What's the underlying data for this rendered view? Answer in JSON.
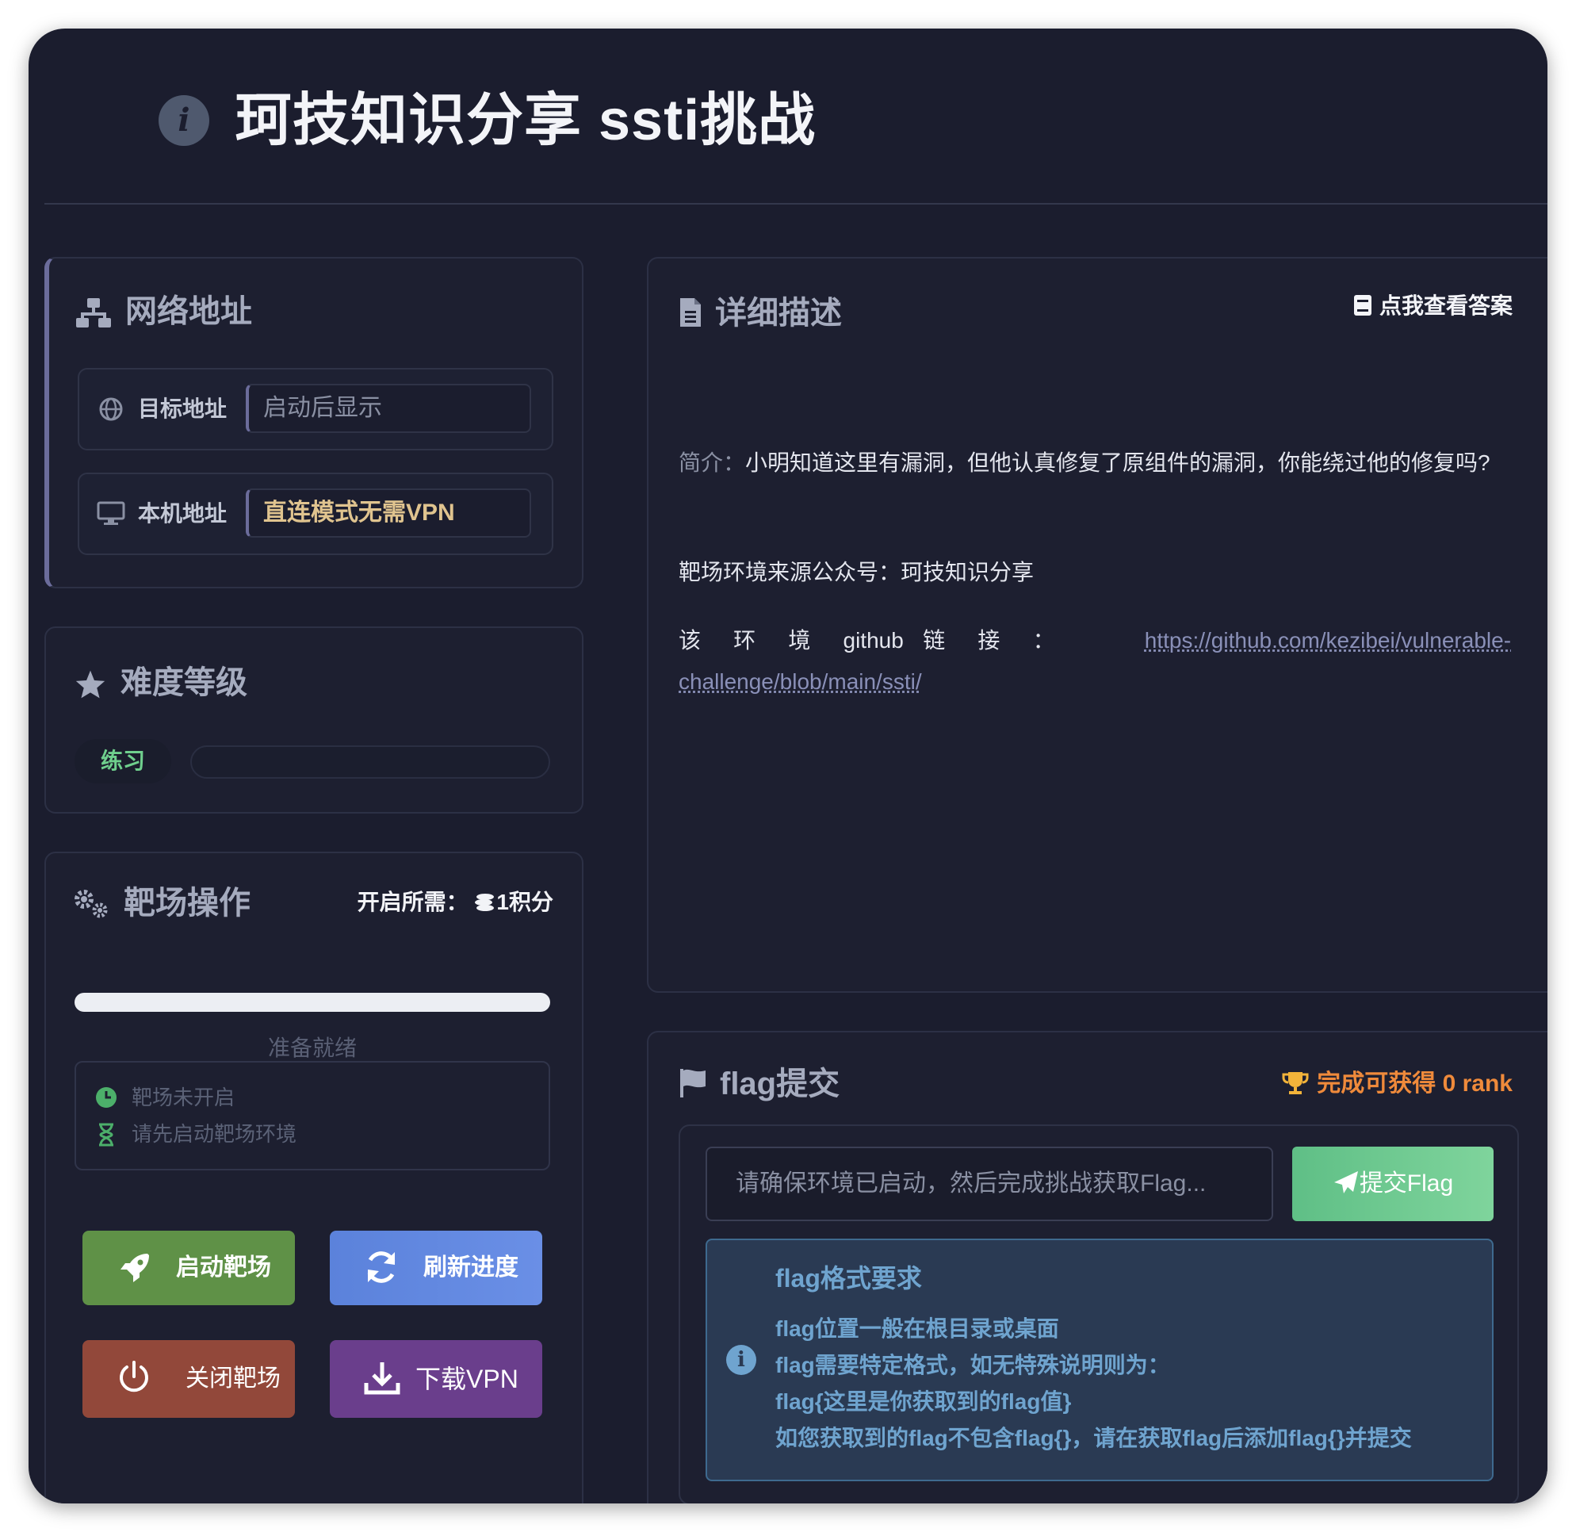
{
  "header": {
    "title": "珂技知识分享 ssti挑战",
    "icon": "info-icon"
  },
  "network": {
    "title": "网络地址",
    "target_label": "目标地址",
    "target_value": "启动后显示",
    "local_label": "本机地址",
    "local_value": "直连模式无需VPN"
  },
  "difficulty": {
    "title": "难度等级",
    "level": "练习",
    "level_color": "#6fcf8d"
  },
  "operations": {
    "title": "靶场操作",
    "cost_label": "开启所需：",
    "cost_value": "1积分",
    "progress_status": "准备就绪",
    "status_line1": "靶场未开启",
    "status_line2": "请先启动靶场环境",
    "start_button": "启动靶场",
    "refresh_button": "刷新进度",
    "stop_button": "关闭靶场",
    "download_button": "下载VPN"
  },
  "detail": {
    "title": "详细描述",
    "answer_link": "点我查看答案",
    "intro_label": "简介：",
    "intro_text": "小明知道这里有漏洞，但他认真修复了原组件的漏洞，你能绕过他的修复吗?",
    "source_text": "靶场环境来源公众号：珂技知识分享",
    "github_label": "该 环 境 github 链 接 ：",
    "github_url": "https://github.com/kezibei/vulnerable-challenge/blob/main/ssti/"
  },
  "flag": {
    "title": "flag提交",
    "reward": "完成可获得 0 rank",
    "input_placeholder": "请确保环境已启动，然后完成挑战获取Flag...",
    "submit_button": "提交Flag",
    "info_title": "flag格式要求",
    "info_line1": "flag位置一般在根目录或桌面",
    "info_line2": "flag需要特定格式，如无特殊说明则为：",
    "info_line3": "flag{这里是你获取到的flag值}",
    "info_line4": "如您获取到的flag不包含flag{}，请在获取flag后添加flag{}并提交"
  }
}
